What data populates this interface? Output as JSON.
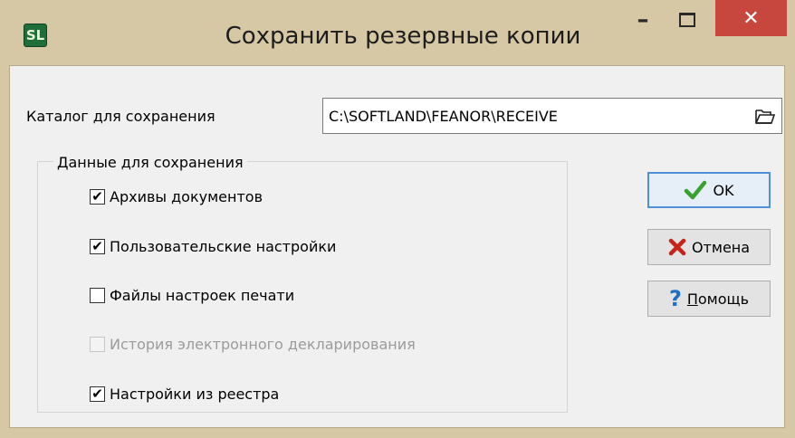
{
  "window": {
    "title": "Сохранить резервные копии",
    "app_icon_glyph": "SL",
    "controls": {
      "minimize": "–",
      "close": "✕"
    }
  },
  "folder": {
    "label": "Каталог для сохранения",
    "value": "C:\\SOFTLAND\\FEANOR\\RECEIVE",
    "browse_icon": "open-folder-icon"
  },
  "data_group": {
    "title": "Данные для сохранения",
    "options": [
      {
        "label": "Архивы документов",
        "checked": true,
        "enabled": true
      },
      {
        "label": "Пользовательские настройки",
        "checked": true,
        "enabled": true
      },
      {
        "label": "Файлы настроек печати",
        "checked": false,
        "enabled": true
      },
      {
        "label": "История электронного декларирования",
        "checked": false,
        "enabled": false
      },
      {
        "label": "Настройки из реестра",
        "checked": true,
        "enabled": true
      }
    ]
  },
  "buttons": {
    "ok": {
      "label": "OK",
      "icon": "checkmark-icon"
    },
    "cancel": {
      "label": "Отмена",
      "icon": "red-x-icon"
    },
    "help": {
      "label_first": "П",
      "label_rest": "омощь",
      "icon": "question-icon"
    }
  },
  "colors": {
    "titlebar_bg": "#d7c8a5",
    "close_button": "#c7463d",
    "ok_check": "#3aa12e",
    "cancel_x": "#c8231b",
    "help_question": "#1f6fc8",
    "default_border": "#4f8ed8"
  }
}
